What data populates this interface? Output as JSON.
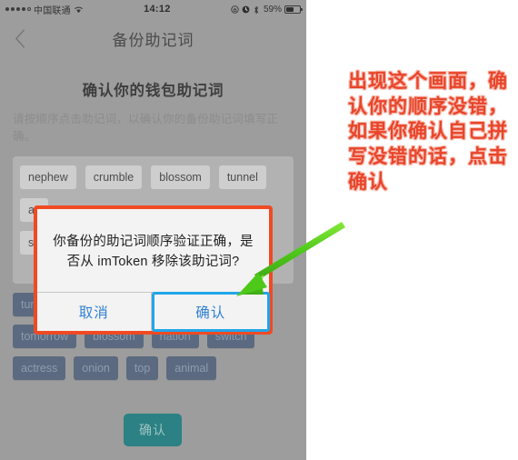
{
  "statusbar": {
    "carrier": "中国联通",
    "signal_dots": 5,
    "signal_filled": 4,
    "wifi_icon": "wifi-icon",
    "time": "14:12",
    "alarm_icon": "alarm-icon",
    "lock_rotation_icon": "rotation-lock-icon",
    "bluetooth_icon": "bluetooth-icon",
    "battery_percent": "59%",
    "battery_level": 59
  },
  "navbar": {
    "back_icon": "chevron-left-icon",
    "title": "备份助记词"
  },
  "page": {
    "title": "确认你的钱包助记词",
    "subtitle": "请按顺序点击助记词，以确认你的备份助记词填写正确。"
  },
  "selected_words": {
    "rows": [
      [
        "nephew",
        "crumble",
        "blossom",
        "tunnel"
      ],
      [
        "ac",
        "",
        "",
        ""
      ],
      [
        "sw",
        "",
        "",
        ""
      ]
    ],
    "row1": [
      "nephew",
      "crumble",
      "blossom",
      "tunnel"
    ],
    "row2_partial": "ac",
    "row3_partial": "sw"
  },
  "word_bank": {
    "rows": [
      [
        "tun"
      ],
      [
        "tomorrow",
        "blossom",
        "nation",
        "switch"
      ],
      [
        "actress",
        "onion",
        "top",
        "animal"
      ]
    ]
  },
  "bottom_button": {
    "label": "确认"
  },
  "dialog": {
    "message": "你备份的助记词顺序验证正确，是否从 imToken 移除该助记词?",
    "cancel_label": "取消",
    "confirm_label": "确认",
    "highlight_border_color": "#f04a23",
    "confirm_highlight_color": "#21a5e8"
  },
  "annotation": {
    "text": "出现这个画面，确认你的顺序没错，如果你确认自己拼写没错的话，点击确认",
    "color": "#e8452a",
    "arrow_icon": "green-arrow-icon",
    "arrow_color": "#55d412"
  }
}
